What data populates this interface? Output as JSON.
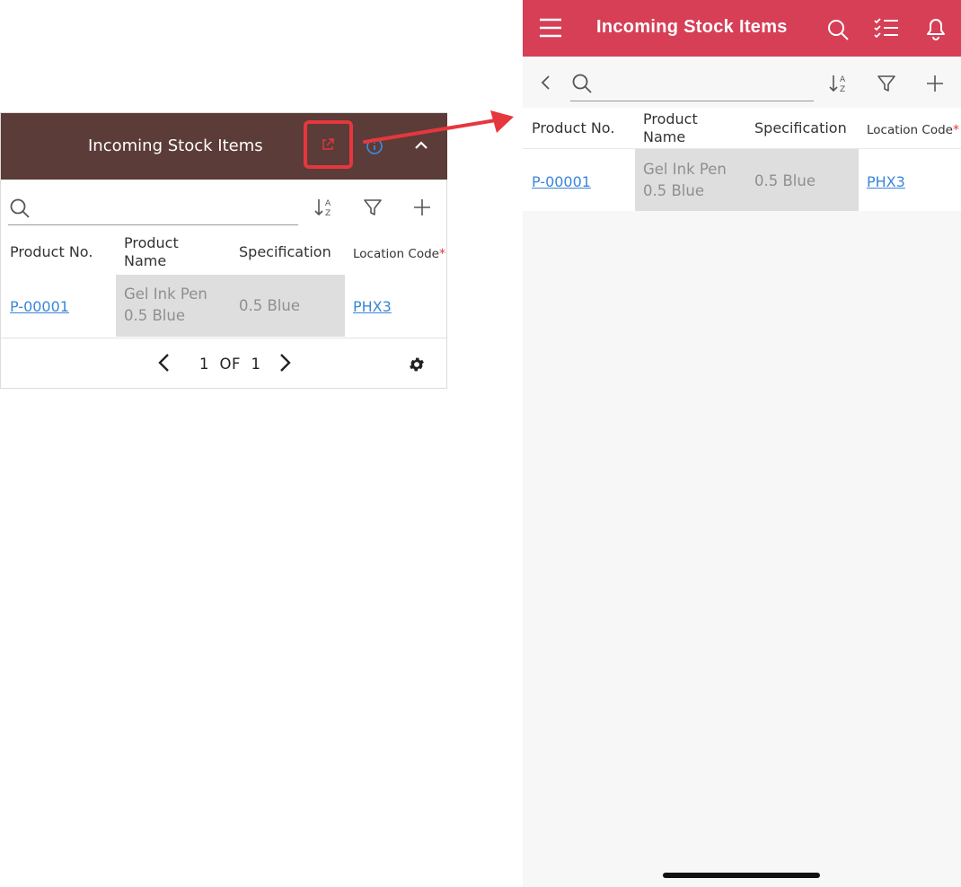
{
  "widget": {
    "title": "Incoming Stock Items",
    "columns": [
      "Product No.",
      "Product\nName",
      "Specification",
      "Location Code"
    ],
    "required_marker": "*",
    "row": {
      "product_no": "P-00001",
      "product_name": "Gel Ink Pen 0.5 Blue",
      "specification": "0.5 Blue",
      "location_code": "PHX3"
    },
    "pager": {
      "text": "1  OF  1"
    }
  },
  "phone": {
    "title": "Incoming Stock Items",
    "columns": [
      "Product No.",
      "Product\nName",
      "Specification",
      "Location Code"
    ],
    "required_marker": "*",
    "row": {
      "product_no": "P-00001",
      "product_name": "Gel Ink Pen 0.5 Blue",
      "specification": "0.5 Blue",
      "location_code": "PHX3"
    }
  },
  "colors": {
    "widget_header": "#5b3c38",
    "phone_header": "#d63f56",
    "highlight": "#e5373d",
    "link": "#3a86d8"
  },
  "icons": [
    "external-link-icon",
    "info-icon",
    "chevron-up-icon",
    "search-icon",
    "sort-az-icon",
    "filter-icon",
    "plus-icon",
    "chevron-left-icon",
    "chevron-right-icon",
    "gear-icon",
    "menu-icon",
    "checklist-icon",
    "bell-icon"
  ]
}
